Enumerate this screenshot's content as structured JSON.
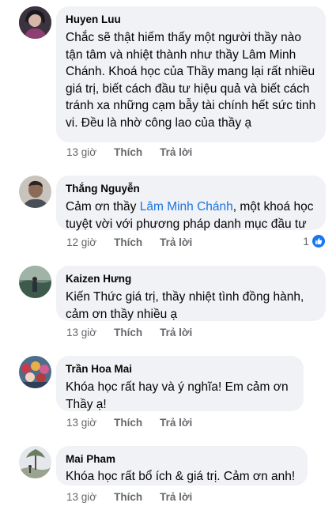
{
  "comments": [
    {
      "author": "Huyen Luu",
      "text": "Chắc sẽ thật hiếm thấy một người thầy nào tận tâm và nhiệt thành như thầy Lâm Minh Chánh. Khoá học của Thầy mang lại rất nhiều giá trị, biết cách đầu tư hiệu quả và biết cách tránh xa những cạm bẫy tài chính hết sức tinh vi. Đều là nhờ công lao của thầy ạ",
      "time": "13 giờ",
      "like": "Thích",
      "reply": "Trả lời"
    },
    {
      "author": "Thắng Nguyễn",
      "text_prefix": "Cảm ơn thầy ",
      "mention": "Lâm Minh Chánh",
      "text_suffix": ", một khoá học tuyệt vời với phương pháp danh mục đầu tư",
      "time": "12 giờ",
      "like": "Thích",
      "reply": "Trả lời",
      "reaction_count": "1",
      "reaction_icon": "like-icon"
    },
    {
      "author": "Kaizen Hưng",
      "text": "Kiến Thức giá trị, thầy nhiệt tình đồng hành, cảm ơn thầy nhiều ạ",
      "time": "13 giờ",
      "like": "Thích",
      "reply": "Trả lời"
    },
    {
      "author": "Trần Hoa Mai",
      "text": "Khóa học rất hay và ý nghĩa! Em cảm ơn Thầy ạ!",
      "time": "13 giờ",
      "like": "Thích",
      "reply": "Trả lời"
    },
    {
      "author": "Mai Pham",
      "text": "Khóa học rất bổ ích & giá trị. Cảm ơn anh!",
      "time": "13 giờ",
      "like": "Thích",
      "reply": "Trả lời"
    }
  ],
  "colors": {
    "bubble": "#f0f2f5",
    "meta": "#65676b",
    "mention": "#1b74e4",
    "like_blue": "#1877f2"
  }
}
